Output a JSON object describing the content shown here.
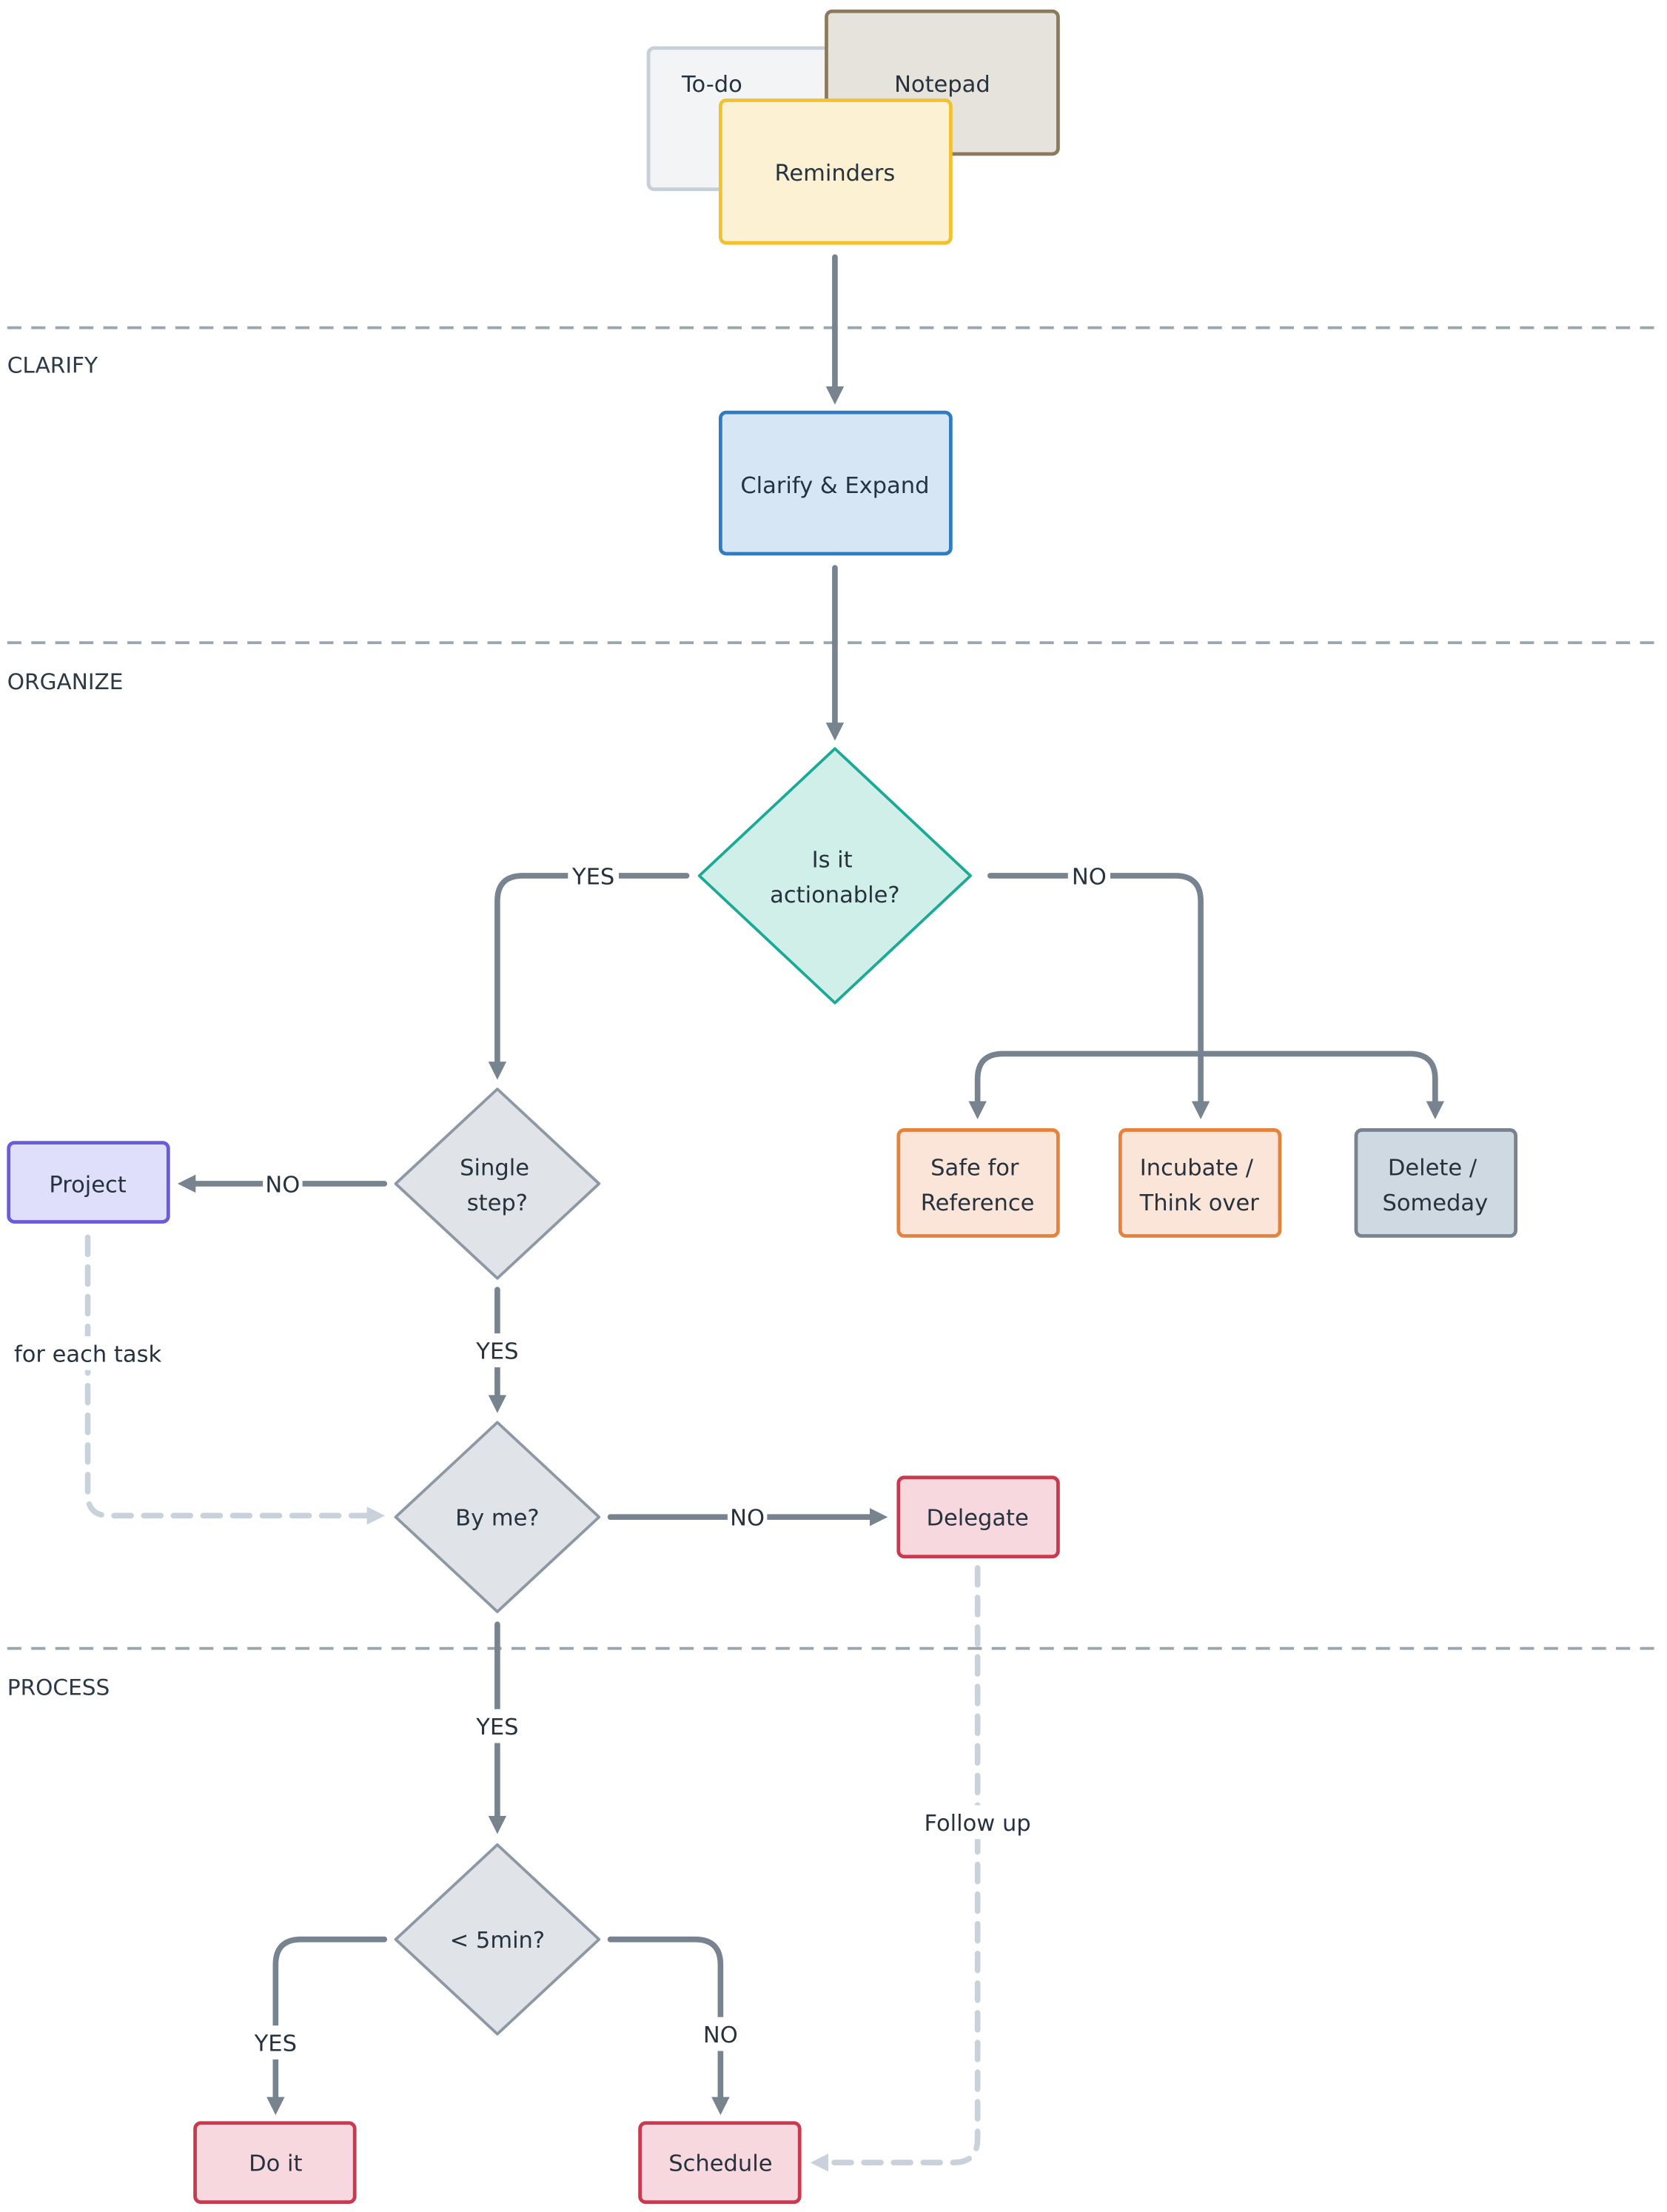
{
  "lanes": {
    "clarify": "CLARIFY",
    "organize": "ORGANIZE",
    "process": "PROCESS"
  },
  "nodes": {
    "todo": "To-do",
    "notepad": "Notepad",
    "reminders": "Reminders",
    "clarify_expand": "Clarify & Expand",
    "actionable": [
      "Is it",
      "actionable?"
    ],
    "safe_reference": [
      "Safe for",
      "Reference"
    ],
    "incubate": [
      "Incubate /",
      "Think over"
    ],
    "delete_someday": [
      "Delete /",
      "Someday"
    ],
    "single_step": [
      "Single",
      "step?"
    ],
    "project": "Project",
    "by_me": "By me?",
    "delegate": "Delegate",
    "under_5min": "< 5min?",
    "do_it": "Do it",
    "schedule": "Schedule"
  },
  "edge_labels": {
    "actionable_yes": "YES",
    "actionable_no": "NO",
    "single_no": "NO",
    "single_yes": "YES",
    "for_each_task": "for each task",
    "by_me_no": "NO",
    "by_me_yes": "YES",
    "min_yes": "YES",
    "min_no": "NO",
    "follow_up": "Follow up"
  },
  "colors": {
    "edge": "#77838f",
    "todo": "#f2f4f6",
    "notepad": "#e6e2dc",
    "reminders": "#fdf1d4",
    "clarify": "#d6e6f5",
    "decision_teal": "#d0efe9",
    "decision_gray": "#e0e3e8",
    "reference": "#fbe4d8",
    "someday": "#cfd9e1",
    "project": "#e0dffb",
    "action_pink": "#f6d8de"
  }
}
